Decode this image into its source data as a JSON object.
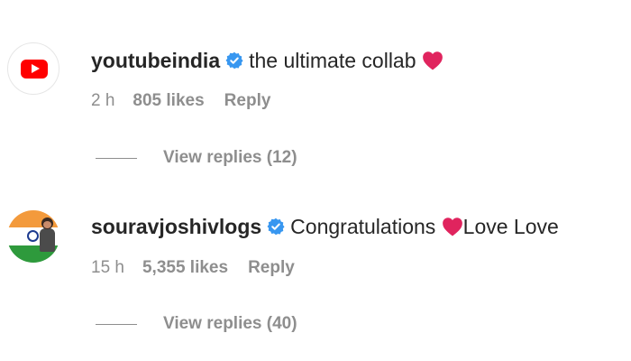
{
  "comments": [
    {
      "username": "youtubeindia",
      "avatar_icon": "youtube-logo-icon",
      "verified": true,
      "text": "the ultimate collab",
      "emoji_after": "heart",
      "text_after": "",
      "time": "2 h",
      "likes": "805 likes",
      "reply_label": "Reply",
      "view_replies": "View replies (12)"
    },
    {
      "username": "souravjoshivlogs",
      "avatar_icon": "india-flag-avatar-icon",
      "verified": true,
      "text": "Congratulations",
      "emoji_after": "heart",
      "text_after": "Love Love",
      "time": "15 h",
      "likes": "5,355 likes",
      "reply_label": "Reply",
      "view_replies": "View replies (40)"
    }
  ],
  "colors": {
    "text": "#262626",
    "muted": "#8e8e8e",
    "verified_blue": "#3897f0",
    "heart_red": "#e0245e",
    "youtube_red": "#ff0000"
  }
}
